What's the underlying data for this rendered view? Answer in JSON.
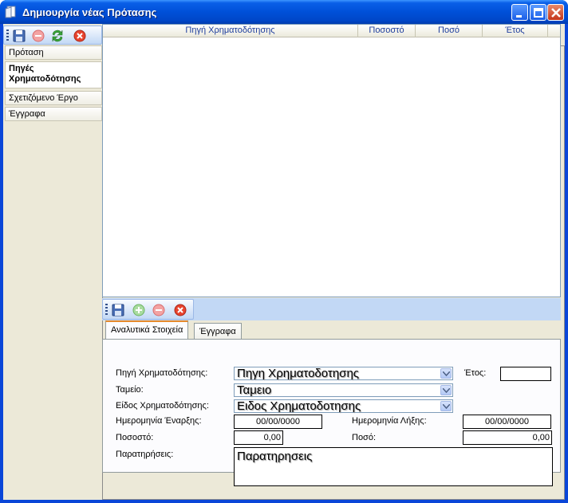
{
  "window": {
    "title": "Δημιουργία νέας Πρότασης",
    "title_icon": "document-icon"
  },
  "toolbar": {
    "items": [
      "save-icon",
      "cancel-icon",
      "refresh-icon",
      "delete-icon"
    ]
  },
  "nav": {
    "items": [
      {
        "label": "Πρόταση",
        "active": false
      },
      {
        "label": "Πηγές Χρηματοδότησης",
        "active": true
      },
      {
        "label": "Σχετιζόμενο Έργο",
        "active": false
      },
      {
        "label": "Έγγραφα",
        "active": false
      }
    ]
  },
  "grid": {
    "columns": [
      "Πηγή Χρηματοδότησης",
      "Ποσοστό",
      "Ποσό",
      "Έτος"
    ],
    "rows": []
  },
  "subtoolbar": {
    "items": [
      "save-icon",
      "add-icon",
      "cancel-icon",
      "delete-icon"
    ]
  },
  "tabs": {
    "items": [
      {
        "label": "Αναλυτικά Στοιχεία",
        "active": true
      },
      {
        "label": "Έγγραφα",
        "active": false
      }
    ]
  },
  "form": {
    "funding_source_label": "Πηγή Χρηματοδότησης:",
    "funding_source_value": "Πηγη Χρηματοδοτησης",
    "year_label": "Έτος:",
    "year_value": "",
    "fund_label": "Ταμείο:",
    "fund_value": "Ταμειο",
    "funding_type_label": "Είδος Χρηματοδότησης:",
    "funding_type_value": "Ειδος Χρηματοδοτησης",
    "start_date_label": "Ημερομηνία Έναρξης:",
    "start_date_value": "00/00/0000",
    "end_date_label": "Ημερομηνία Λήξης:",
    "end_date_value": "00/00/0000",
    "percentage_label": "Ποσοστό:",
    "percentage_value": "0,00",
    "amount_label": "Ποσό:",
    "amount_value": "0,00",
    "notes_label": "Παρατηρήσεις:",
    "notes_value": "Παρατηρησεις"
  },
  "colors": {
    "titlebar": "#0050d8",
    "client_bg": "#ece9d8",
    "header_text": "#1c3c9c",
    "active_tab_accent": "#e68b2c"
  }
}
